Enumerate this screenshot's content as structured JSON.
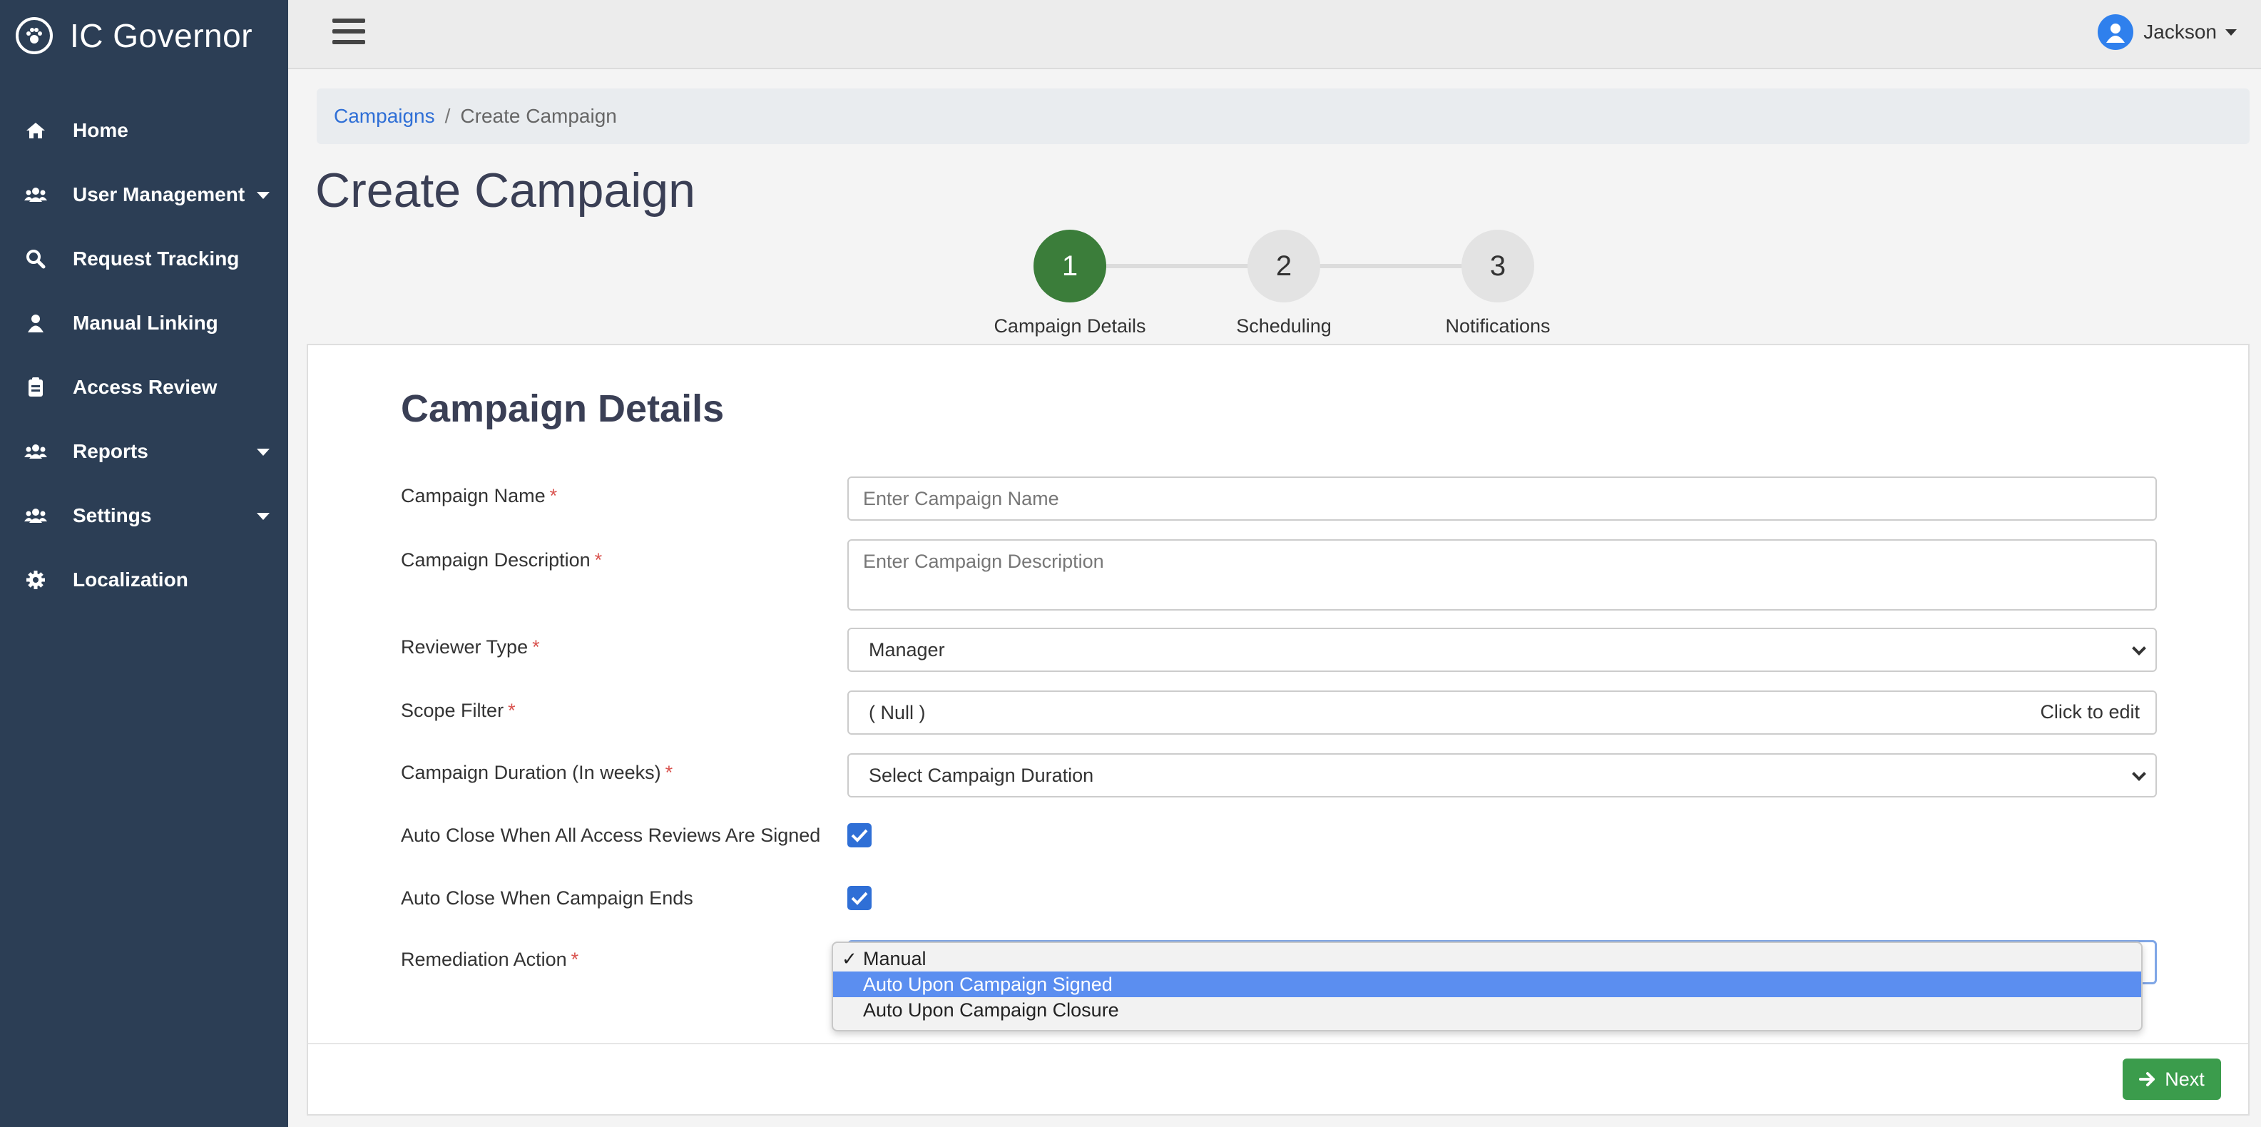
{
  "app": {
    "title": "IC Governor"
  },
  "sidebar": {
    "items": [
      {
        "label": "Home",
        "icon": "home-icon"
      },
      {
        "label": "User Management",
        "icon": "users-icon",
        "has_submenu": true
      },
      {
        "label": "Request Tracking",
        "icon": "search-icon"
      },
      {
        "label": "Manual Linking",
        "icon": "user-icon"
      },
      {
        "label": "Access Review",
        "icon": "clipboard-icon"
      },
      {
        "label": "Reports",
        "icon": "users-icon",
        "has_submenu": true
      },
      {
        "label": "Settings",
        "icon": "users-icon",
        "has_submenu": true
      },
      {
        "label": "Localization",
        "icon": "gear-icon"
      }
    ]
  },
  "header": {
    "user_name": "Jackson"
  },
  "breadcrumb": {
    "parent": "Campaigns",
    "separator": "/",
    "current": "Create Campaign"
  },
  "page": {
    "title": "Create Campaign"
  },
  "stepper": {
    "steps": [
      {
        "number": "1",
        "label": "Campaign Details",
        "active": true
      },
      {
        "number": "2",
        "label": "Scheduling",
        "active": false
      },
      {
        "number": "3",
        "label": "Notifications",
        "active": false
      }
    ]
  },
  "form": {
    "title": "Campaign Details",
    "required_mark": "*",
    "campaign_name": {
      "label": "Campaign Name",
      "placeholder": "Enter Campaign Name"
    },
    "campaign_description": {
      "label": "Campaign Description",
      "placeholder": "Enter Campaign Description"
    },
    "reviewer_type": {
      "label": "Reviewer Type",
      "value": "Manager"
    },
    "scope_filter": {
      "label": "Scope Filter",
      "value": "( Null )",
      "action": "Click to edit"
    },
    "campaign_duration": {
      "label": "Campaign Duration (In weeks)",
      "value": "Select Campaign Duration"
    },
    "auto_close_signed": {
      "label": "Auto Close When All Access Reviews Are Signed",
      "checked": true
    },
    "auto_close_ends": {
      "label": "Auto Close When Campaign Ends",
      "checked": true
    },
    "remediation_action": {
      "label": "Remediation Action",
      "options": [
        "Manual",
        "Auto Upon Campaign Signed",
        "Auto Upon Campaign Closure"
      ],
      "selected": "Manual",
      "highlighted": "Auto Upon Campaign Signed",
      "check_mark": "✓"
    }
  },
  "footer": {
    "next_label": "Next"
  },
  "colors": {
    "sidebar_bg": "#2c3e55",
    "accent_green": "#3b7d3a",
    "button_green": "#3b9c4c",
    "link_blue": "#2f6fd6",
    "highlight_blue": "#5b8ef0"
  }
}
